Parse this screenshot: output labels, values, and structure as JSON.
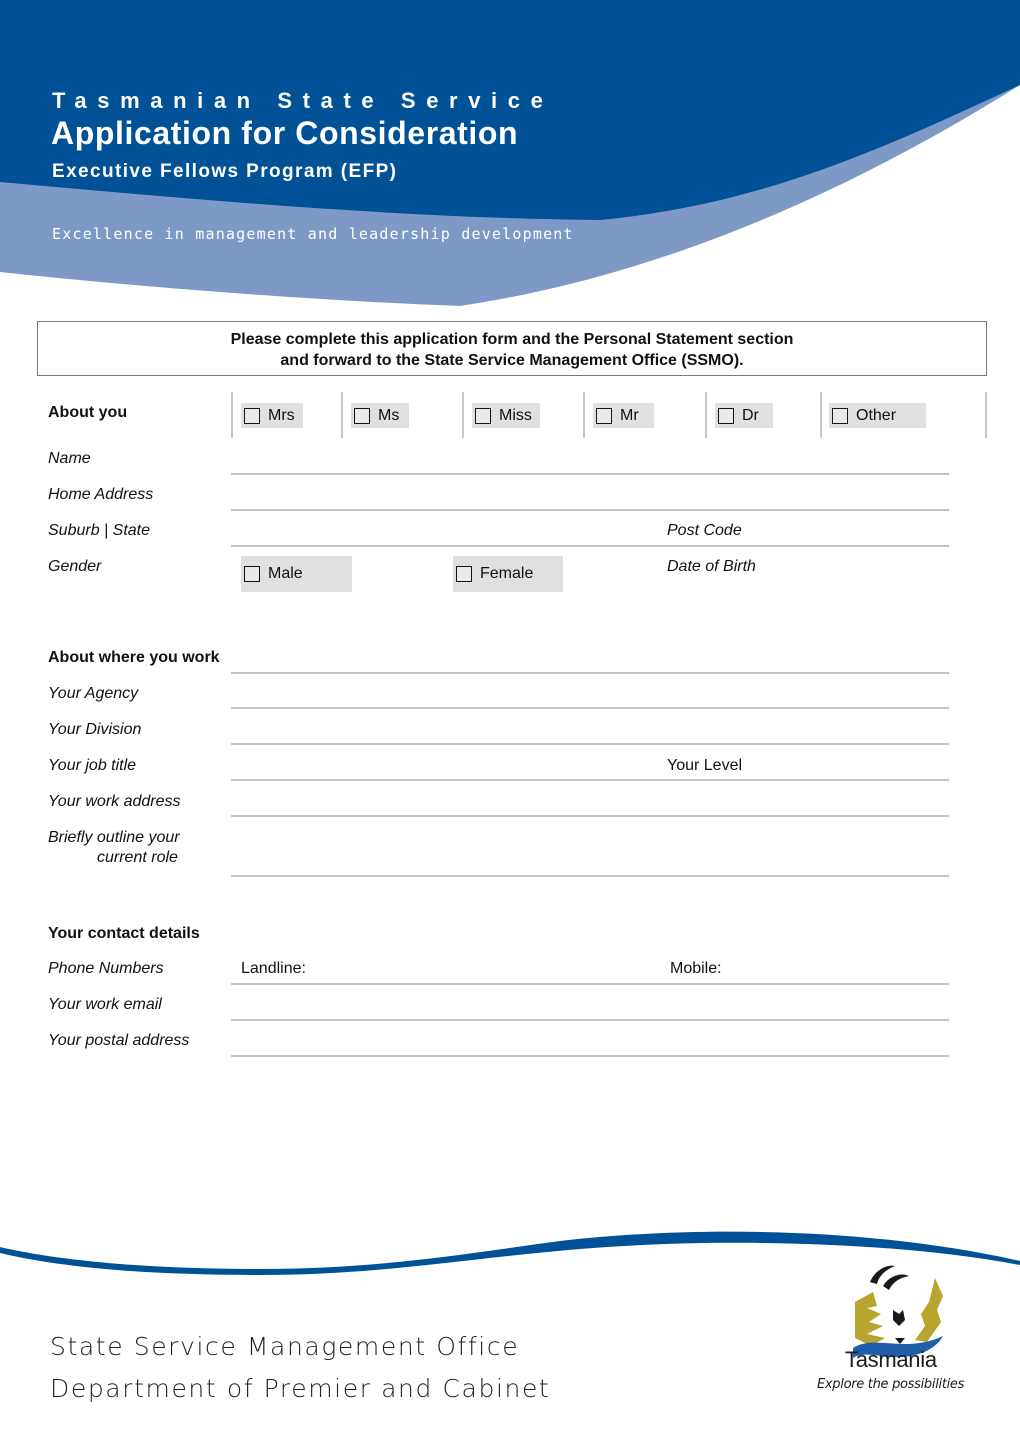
{
  "header": {
    "kicker": "Tasmanian State Service",
    "title": "Application for Consideration",
    "subtitle": "Executive Fellows Program (EFP)",
    "tagline": "Excellence in management and leadership development",
    "colors": {
      "dark_blue": "#005196",
      "light_blue": "#7f99c6"
    }
  },
  "notice": {
    "line1": "Please complete this application form and the Personal Statement section",
    "line2": "and forward to the State Service Management Office (SSMO)."
  },
  "about_you": {
    "heading": "About you",
    "titles": [
      "Mrs",
      "Ms",
      "Miss",
      "Mr",
      "Dr",
      "Other"
    ],
    "fields": {
      "name": "Name",
      "home_address": "Home Address",
      "suburb_state": "Suburb | State",
      "post_code": "Post Code",
      "gender": "Gender",
      "date_of_birth": "Date of Birth"
    },
    "gender_options": [
      "Male",
      "Female"
    ]
  },
  "work": {
    "heading": "About where you work",
    "fields": {
      "agency": "Your Agency",
      "division": "Your Division",
      "job_title": "Your job title",
      "level": "Your Level",
      "work_address": "Your work address",
      "role_line1": "Briefly outline your",
      "role_line2": "current role"
    }
  },
  "contact": {
    "heading": "Your contact details",
    "fields": {
      "phone": "Phone Numbers",
      "landline": "Landline:",
      "mobile": "Mobile:",
      "work_email": "Your work email",
      "postal_address": "Your postal address"
    }
  },
  "footer": {
    "line1": "State Service Management Office",
    "line2": "Department of Premier and Cabinet",
    "logo_word": "Tasmania",
    "logo_tagline": "Explore the possibilities"
  }
}
